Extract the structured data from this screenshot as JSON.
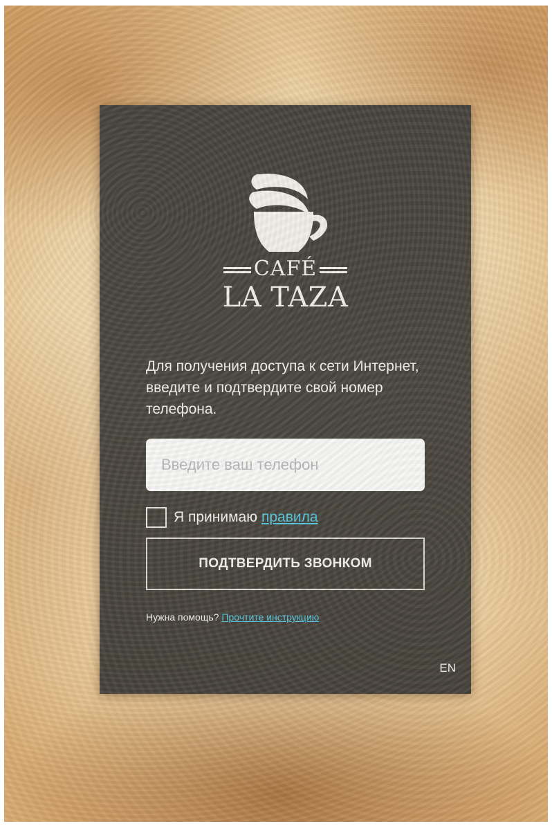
{
  "brand": {
    "line1": "CAFÉ",
    "line2": "LA TAZA"
  },
  "intro_text": "Для получения доступа к сети Интернет, введите и подтвердите свой номер телефона.",
  "phone_input": {
    "placeholder": "Введите ваш телефон",
    "value": ""
  },
  "terms": {
    "label": "Я принимаю",
    "link_text": "правила",
    "checked": false
  },
  "confirm_button": {
    "label": "ПОДТВЕРДИТЬ ЗВОНКОМ"
  },
  "help": {
    "question": "Нужна помощь?",
    "link_text": "Прочтите инструкцию"
  },
  "language_switch": {
    "label": "EN"
  },
  "colors": {
    "card_background": "#4a463f",
    "link": "#56c6de",
    "input_background": "#f7f7f6",
    "text": "#f3f0ea"
  },
  "icons": {
    "logo": "coffee-cup-logo-icon"
  }
}
